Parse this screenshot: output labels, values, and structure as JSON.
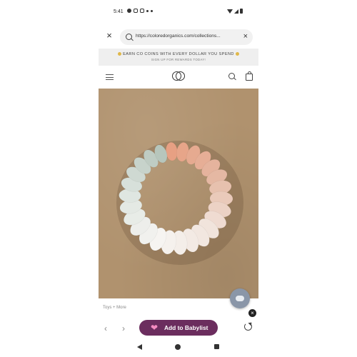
{
  "status_bar": {
    "time": "5:41",
    "icons": [
      "chat-bubble-icon",
      "instagram-icon",
      "instagram-icon",
      "share-icon",
      "dot-icon"
    ],
    "right_icons": [
      "wifi-icon",
      "signal-icon",
      "battery-icon"
    ]
  },
  "browser": {
    "url": "https://coloredorganics.com/collections...",
    "close_icon": "×",
    "clear_icon": "×"
  },
  "promo": {
    "line1": "EARN CO COINS WITH EVERY DOLLAR YOU SPEND",
    "line2": "SIGN UP FOR REWARDS TODAY!"
  },
  "product": {
    "image_alt": "silicone bead teether ring",
    "bead_colors": [
      "#e7a083",
      "#e5b8a3",
      "#f1e4dc",
      "#f6f4f1",
      "#dfe6e1",
      "#b7c6bc"
    ]
  },
  "page": {
    "breadcrumb": "Toys + More"
  },
  "toolbar": {
    "back": "‹",
    "forward": "›",
    "babylist_label": "Add to Babylist",
    "accent": "#6b2d5e"
  },
  "navbar": {
    "icons": [
      "back-triangle-icon",
      "home-circle-icon",
      "recents-square-icon"
    ]
  }
}
